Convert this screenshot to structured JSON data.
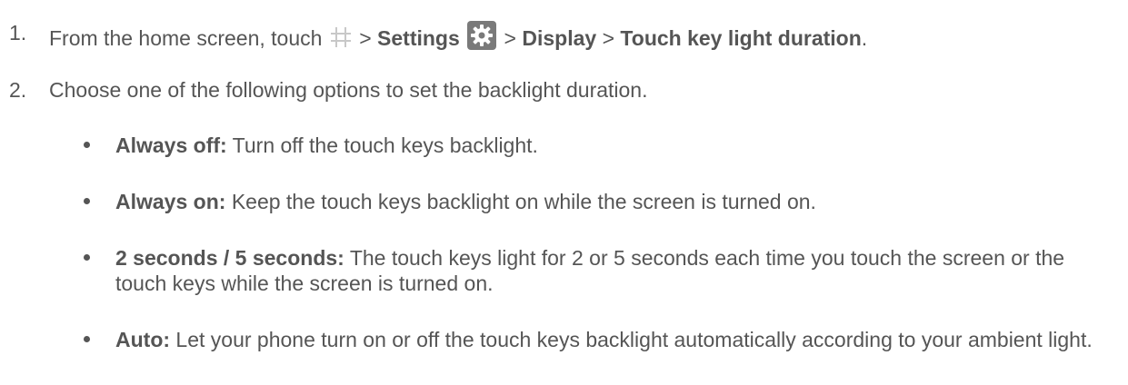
{
  "steps": [
    {
      "number": "1.",
      "prefix": "From the home screen, touch",
      "sep1": ">",
      "settings": "Settings",
      "sep2": ">",
      "display": "Display",
      "sep3": ">",
      "target": "Touch key light duration",
      "end": "."
    },
    {
      "number": "2.",
      "text": "Choose one of the following options to set the backlight duration."
    }
  ],
  "icons": {
    "apps": "apps-grid-icon",
    "settings": "settings-gear-icon",
    "gear_color": "#7a7a7a",
    "apps_color": "#c8c8c8"
  },
  "options": [
    {
      "label": "Always off:",
      "desc": "Turn off the touch keys backlight."
    },
    {
      "label": "Always on:",
      "desc": "Keep the touch keys backlight on while the screen is turned on."
    },
    {
      "label": "2 seconds / 5 seconds:",
      "desc": "The touch keys light for 2 or 5 seconds each time you touch the screen or the touch keys while the screen is turned on."
    },
    {
      "label": "Auto:",
      "desc": "Let your phone turn on or off the touch keys backlight automatically according to your ambient light."
    }
  ]
}
